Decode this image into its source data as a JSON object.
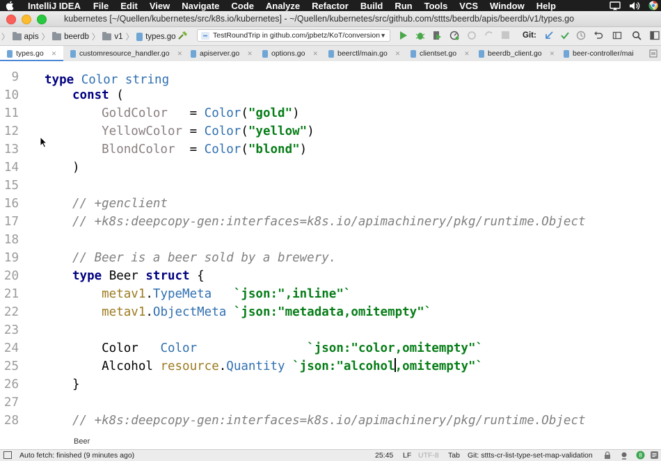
{
  "menubar": {
    "app_name": "IntelliJ IDEA",
    "items": [
      "File",
      "Edit",
      "View",
      "Navigate",
      "Code",
      "Analyze",
      "Refactor",
      "Build",
      "Run",
      "Tools",
      "VCS",
      "Window",
      "Help"
    ]
  },
  "window": {
    "title": "kubernetes [~/Quellen/kubernetes/src/k8s.io/kubernetes] - ~/Quellen/kubernetes/src/github.com/sttts/beerdb/apis/beerdb/v1/types.go"
  },
  "navbar": {
    "breadcrumbs": [
      "apis",
      "beerdb",
      "v1",
      "types.go"
    ],
    "run_config": "TestRoundTrip in github.com/jpbetz/KoT/conversion",
    "vcs_label": "Git:"
  },
  "tabs": [
    {
      "label": "types.go",
      "active": true
    },
    {
      "label": "customresource_handler.go",
      "active": false
    },
    {
      "label": "apiserver.go",
      "active": false
    },
    {
      "label": "options.go",
      "active": false
    },
    {
      "label": "beerctl/main.go",
      "active": false
    },
    {
      "label": "clientset.go",
      "active": false
    },
    {
      "label": "beerdb_client.go",
      "active": false
    },
    {
      "label": "beer-controller/mai",
      "active": false
    }
  ],
  "editor": {
    "lines": [
      {
        "n": "9",
        "spans": []
      },
      {
        "n": "10",
        "spans": [
          {
            "t": "const",
            "c": "kw"
          },
          {
            "t": " (",
            "c": ""
          }
        ]
      },
      {
        "n": "11",
        "spans": [
          {
            "t": "    GoldColor   ",
            "c": "cn"
          },
          {
            "t": "= ",
            "c": ""
          },
          {
            "t": "Color",
            "c": "ty"
          },
          {
            "t": "(",
            "c": ""
          },
          {
            "t": "\"gold\"",
            "c": "str"
          },
          {
            "t": ")",
            "c": ""
          }
        ]
      },
      {
        "n": "12",
        "spans": [
          {
            "t": "    YellowColor ",
            "c": "cn"
          },
          {
            "t": "= ",
            "c": ""
          },
          {
            "t": "Color",
            "c": "ty"
          },
          {
            "t": "(",
            "c": ""
          },
          {
            "t": "\"yellow\"",
            "c": "str"
          },
          {
            "t": ")",
            "c": ""
          }
        ]
      },
      {
        "n": "13",
        "spans": [
          {
            "t": "    BlondColor  ",
            "c": "cn"
          },
          {
            "t": "= ",
            "c": ""
          },
          {
            "t": "Color",
            "c": "ty"
          },
          {
            "t": "(",
            "c": ""
          },
          {
            "t": "\"blond\"",
            "c": "str"
          },
          {
            "t": ")",
            "c": ""
          }
        ]
      },
      {
        "n": "14",
        "spans": [
          {
            "t": ")",
            "c": ""
          }
        ]
      },
      {
        "n": "15",
        "spans": []
      },
      {
        "n": "16",
        "spans": [
          {
            "t": "// +genclient",
            "c": "cm"
          }
        ]
      },
      {
        "n": "17",
        "spans": [
          {
            "t": "// +k8s:deepcopy-gen:interfaces=k8s.io/apimachinery/pkg/runtime.Object",
            "c": "cm"
          }
        ]
      },
      {
        "n": "18",
        "spans": []
      },
      {
        "n": "19",
        "spans": [
          {
            "t": "// Beer is a beer sold by a brewery.",
            "c": "cm"
          }
        ]
      },
      {
        "n": "20",
        "spans": [
          {
            "t": "type",
            "c": "kw"
          },
          {
            "t": " Beer ",
            "c": ""
          },
          {
            "t": "struct",
            "c": "kw"
          },
          {
            "t": " {",
            "c": ""
          }
        ]
      },
      {
        "n": "21",
        "spans": [
          {
            "t": "    metav1",
            "c": "pk"
          },
          {
            "t": ".",
            "c": ""
          },
          {
            "t": "TypeMeta",
            "c": "ty"
          },
          {
            "t": "   ",
            "c": ""
          },
          {
            "t": "`json:\",inline\"`",
            "c": "str"
          }
        ]
      },
      {
        "n": "22",
        "spans": [
          {
            "t": "    metav1",
            "c": "pk"
          },
          {
            "t": ".",
            "c": ""
          },
          {
            "t": "ObjectMeta",
            "c": "ty"
          },
          {
            "t": " ",
            "c": ""
          },
          {
            "t": "`json:\"metadata,omitempty\"`",
            "c": "str"
          }
        ]
      },
      {
        "n": "23",
        "spans": []
      },
      {
        "n": "24",
        "spans": [
          {
            "t": "    Color   ",
            "c": ""
          },
          {
            "t": "Color",
            "c": "ty"
          },
          {
            "t": "               ",
            "c": ""
          },
          {
            "t": "`json:\"color,omitempty\"`",
            "c": "str"
          }
        ]
      },
      {
        "n": "25",
        "spans": [
          {
            "t": "    Alcohol ",
            "c": ""
          },
          {
            "t": "resource",
            "c": "pk"
          },
          {
            "t": ".",
            "c": ""
          },
          {
            "t": "Quantity",
            "c": "ty"
          },
          {
            "t": " ",
            "c": ""
          },
          {
            "t": "`json:\"alcohol",
            "c": "str"
          },
          {
            "t": "",
            "c": "caret"
          },
          {
            "t": ",omitempty\"`",
            "c": "str"
          }
        ]
      },
      {
        "n": "26",
        "spans": [
          {
            "t": "}",
            "c": ""
          }
        ]
      },
      {
        "n": "27",
        "spans": []
      },
      {
        "n": "28",
        "spans": [
          {
            "t": "// +k8s:deepcopy-gen:interfaces=k8s.io/apimachinery/pkg/runtime.Object",
            "c": "cm"
          }
        ]
      }
    ],
    "breadcrumb": "Beer"
  },
  "statusbar": {
    "message": "Auto fetch: finished (9 minutes ago)",
    "position": "25:45",
    "line_sep": "LF",
    "encoding": "UTF-8",
    "indent": "Tab",
    "branch": "Git: sttts-cr-list-type-set-map-validation"
  },
  "colors": {
    "keyword": "#000080",
    "comment": "#808080",
    "string": "#067d17",
    "type": "#2f6fb0",
    "tab_accent": "#4a88d6"
  }
}
